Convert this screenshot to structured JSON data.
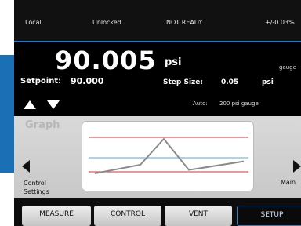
{
  "status": {
    "mode": "Local",
    "lock": "Unlocked",
    "ready": "NOT READY",
    "accuracy": "+/-0.03%"
  },
  "reading": {
    "value": "90.005",
    "unit": "psi",
    "mode": "gauge"
  },
  "setpoint": {
    "label": "Setpoint:",
    "value": "90.000"
  },
  "step_size": {
    "label": "Step Size:",
    "value": "0.05",
    "unit": "psi"
  },
  "auto": {
    "label": "Auto:",
    "value": "200 psi gauge"
  },
  "panel": {
    "title": "Graph",
    "left_label": "Control Settings",
    "right_label": "Main"
  },
  "nav": {
    "measure": "MEASURE",
    "control": "CONTROL",
    "vent": "VENT",
    "setup": "SETUP"
  },
  "graph": {
    "trace": [
      0.0,
      0.25,
      1.0,
      0.1,
      0.35
    ],
    "line_colors": {
      "upper": "#e05b5b",
      "middle": "#7ab8e0",
      "lower": "#e05b5b",
      "trace": "#8a8a8a"
    }
  },
  "colors": {
    "accent_blue": "#1e7bd0",
    "panel_blue": "#1b6fb5"
  }
}
